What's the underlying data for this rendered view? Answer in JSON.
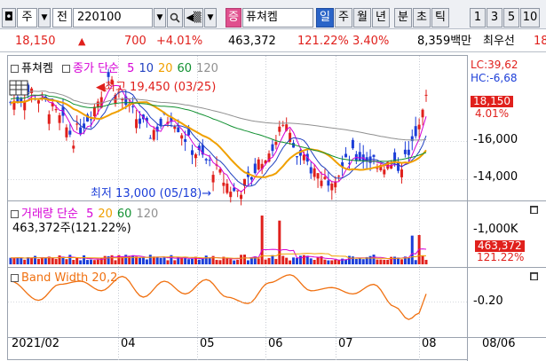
{
  "toolbar": {
    "type_select": "주",
    "prev_label": "전",
    "code_value": "220100",
    "badge_label": "증",
    "stock_name": "퓨쳐켐",
    "period_tabs": [
      "일",
      "주",
      "월",
      "년",
      "분",
      "초",
      "틱"
    ],
    "selected_period": "일",
    "interval_options": [
      "1",
      "3",
      "5",
      "10"
    ]
  },
  "quote": {
    "price": "18,150",
    "change": "700",
    "change_pct": "+4.01%",
    "volume": "463,372",
    "volume_ratio": "121.22%",
    "turnover": "3.40%",
    "amount": "8,359백만",
    "seller": "최우선",
    "seller_price": "18"
  },
  "price_pane": {
    "title": "퓨쳐켐",
    "ma_title": "종가 단순",
    "ma_periods": [
      "5",
      "10",
      "20",
      "60",
      "120"
    ],
    "ma_colors": [
      "#d600d6",
      "#2040c0",
      "#f0a000",
      "#109030",
      "#909090"
    ],
    "high_label": "최고 19,450 (03/25)",
    "low_label": "최저 13,000 (05/18)",
    "lc_label": "LC:39,62",
    "hc_label": "HC:-6,68",
    "price_tag": "18,150",
    "pct_tag": "4.01%",
    "axis_ticks": [
      "16,000",
      "14,000"
    ],
    "up_color": "#e0201c",
    "down_color": "#1c3ed8"
  },
  "volume_pane": {
    "title": "거래량 단순",
    "ma_periods": [
      "5",
      "20",
      "60",
      "120"
    ],
    "ma_colors": [
      "#d600d6",
      "#f0a000",
      "#109030",
      "#909090"
    ],
    "value_label": "463,372주(121.22%)",
    "axis_ticks": [
      "1,000K"
    ],
    "volume_tag": "463,372",
    "ratio_tag": "121.22%"
  },
  "band_pane": {
    "title": "Band Width 20,2",
    "axis_ticks": [
      "0.20"
    ],
    "line_color": "#f07010"
  },
  "date_axis": {
    "labels": [
      "2021/02",
      "04",
      "05",
      "06",
      "07",
      "08"
    ],
    "end_label": "08/06"
  }
}
